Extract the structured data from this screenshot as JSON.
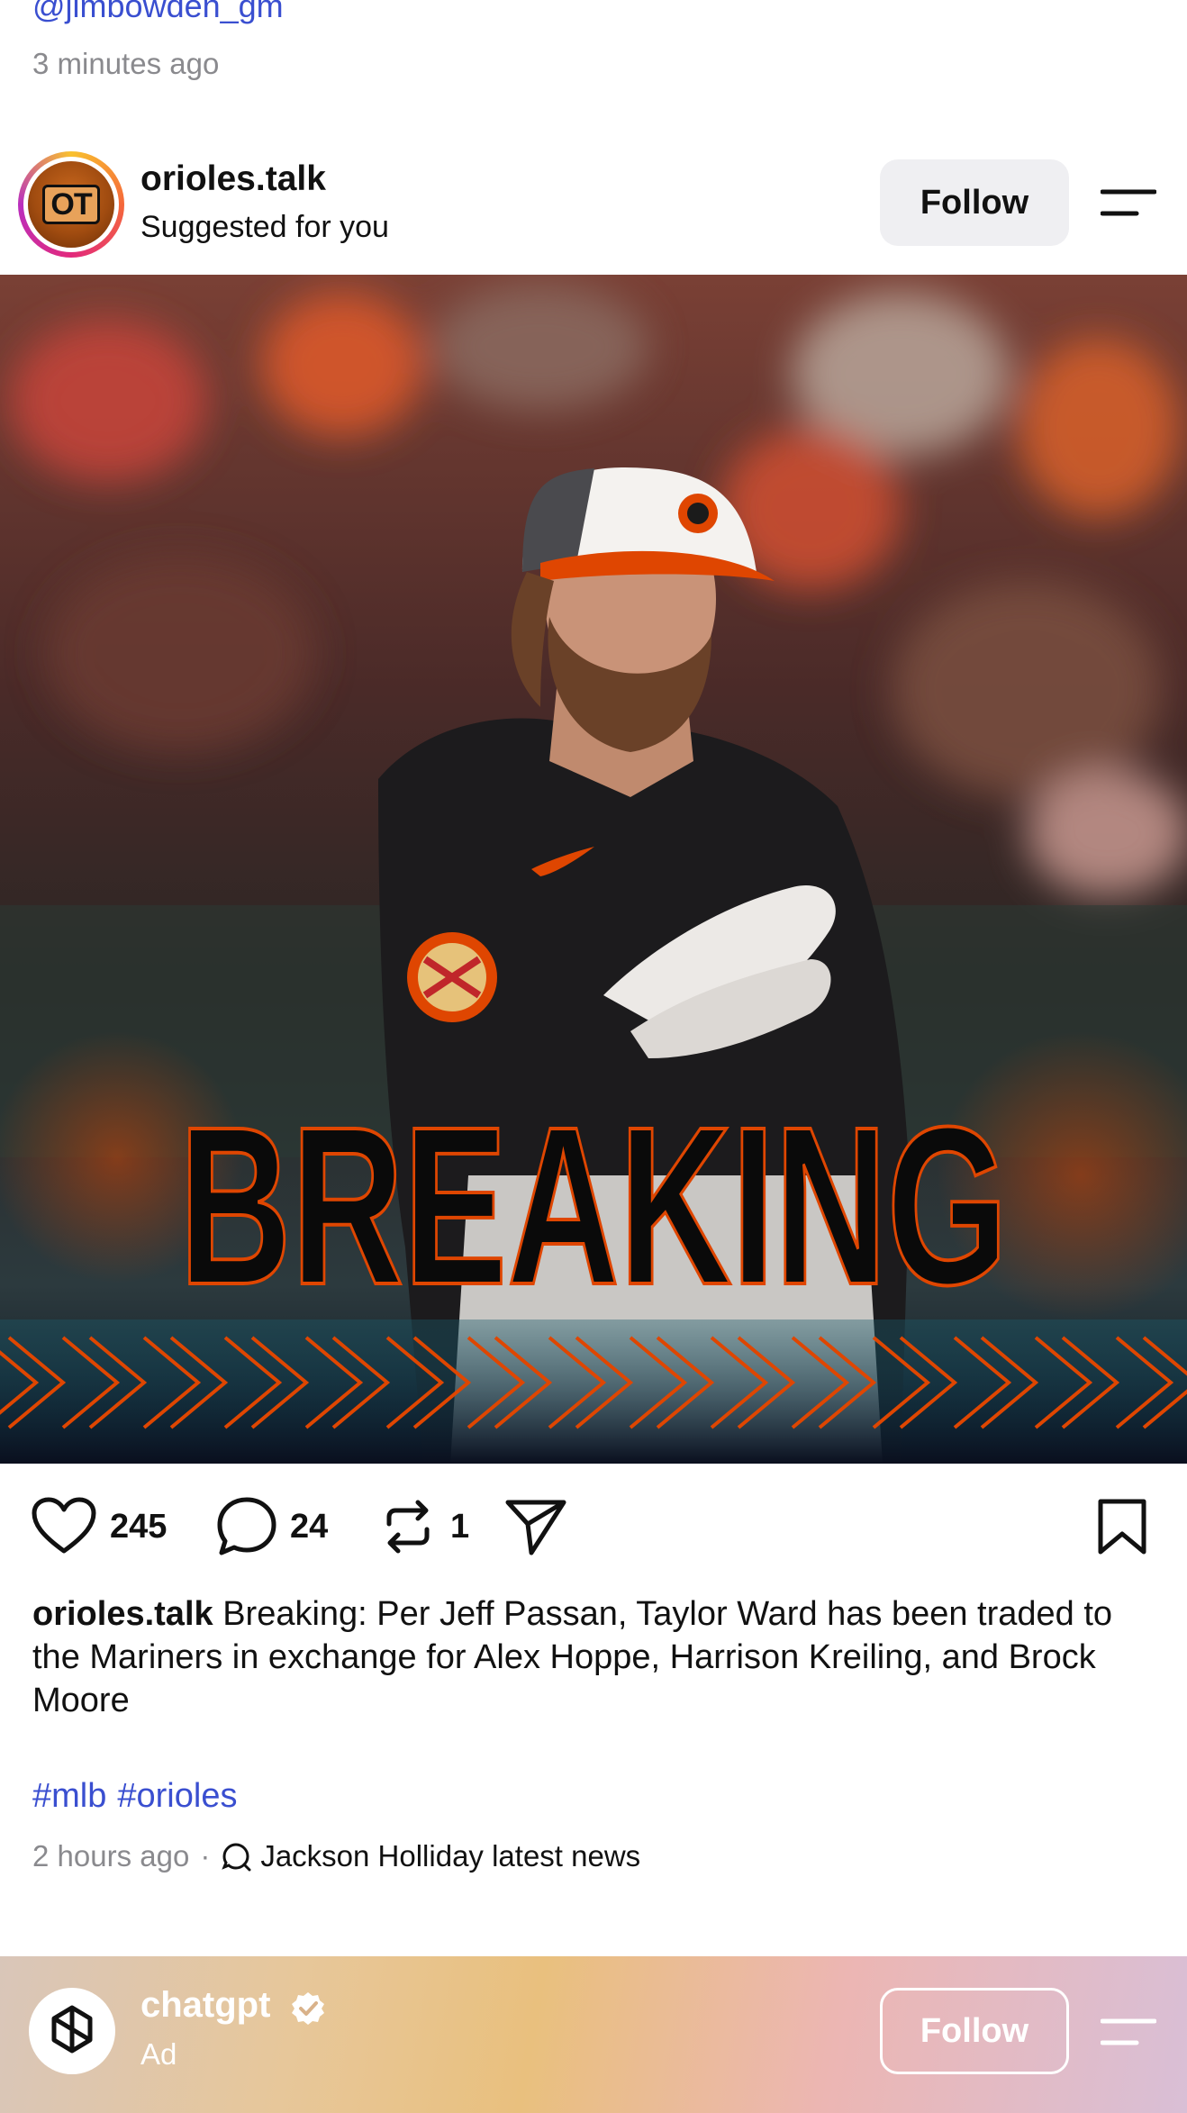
{
  "previous_post": {
    "handle": "@jimbowden_gm",
    "time": "3 minutes ago"
  },
  "post": {
    "username": "orioles.talk",
    "subtitle": "Suggested for you",
    "follow_label": "Follow",
    "avatar_text": "OT",
    "image_overlay_text": "BREAKING",
    "likes": "245",
    "comments": "24",
    "reposts": "1",
    "caption_user": "orioles.talk",
    "caption_text": " Breaking: Per Jeff Passan, Taylor Ward has been traded to the Mariners in exchange for Alex Hoppe, Harrison Kreiling, and Brock Moore",
    "hashtags": [
      "#mlb",
      "#orioles"
    ],
    "time": "2 hours ago",
    "separator": "·",
    "topic": "Jackson Holliday latest news"
  },
  "ad_post": {
    "username": "chatgpt",
    "label": "Ad",
    "follow_label": "Follow"
  },
  "colors": {
    "link": "#3a4fd0",
    "muted": "#8a8a8e",
    "orioles_orange": "#df4601"
  }
}
